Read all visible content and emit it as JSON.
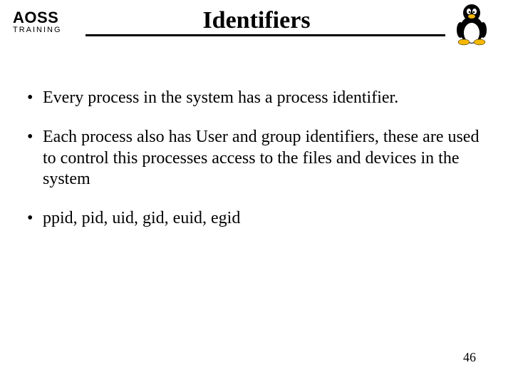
{
  "logo": {
    "line1": "AOSS",
    "line2": "TRAINING"
  },
  "title": "Identifiers",
  "bullets": [
    "Every process in the system has a process identifier.",
    "Each process also has User and group identifiers, these are used to control this processes access to the files and devices in the system",
    "ppid, pid, uid, gid, euid, egid"
  ],
  "page_number": "46"
}
